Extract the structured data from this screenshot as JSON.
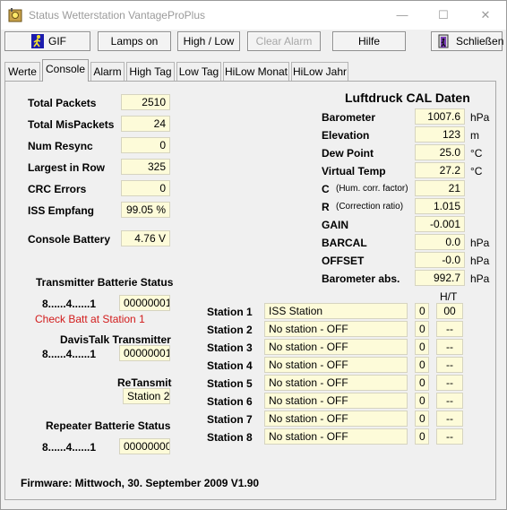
{
  "window": {
    "title": "Status Wetterstation VantageProPlus",
    "min_glyph": "—",
    "max_glyph": "☐",
    "close_glyph": "✕"
  },
  "toolbar": {
    "gif": "GIF",
    "lamps_on": "Lamps on",
    "high_low": "High / Low",
    "clear_alarm": "Clear Alarm",
    "hilfe": "Hilfe",
    "schliessen": "Schließen"
  },
  "tabs": [
    "Werte",
    "Console",
    "Alarm",
    "High Tag",
    "Low Tag",
    "HiLow Monat",
    "HiLow Jahr"
  ],
  "console": {
    "total_packets": {
      "label": "Total Packets",
      "value": "2510"
    },
    "total_mispackets": {
      "label": "Total MisPackets",
      "value": "24"
    },
    "num_resync": {
      "label": "Num Resync",
      "value": "0"
    },
    "largest_in_row": {
      "label": "Largest in Row",
      "value": "325"
    },
    "crc_errors": {
      "label": "CRC Errors",
      "value": "0"
    },
    "iss_empfang": {
      "label": "ISS Empfang",
      "value": "99.05 %"
    },
    "console_battery": {
      "label": "Console Battery",
      "value": "4.76 V"
    }
  },
  "transmitter": {
    "heading": "Transmitter Batterie Status",
    "bits_label": "8......4......1",
    "value": "00000001",
    "warning": "Check Batt at Station 1",
    "davistalk_heading": "DavisTalk Transmitter",
    "davistalk_bits_label": "8......4......1",
    "davistalk_value": "00000001",
    "retransmit_heading": "ReTansmit",
    "retransmit_value": "Station 2",
    "repeater_heading": "Repeater Batterie Status",
    "repeater_bits_label": "8......4......1",
    "repeater_value": "00000000"
  },
  "cal": {
    "heading": "Luftdruck CAL Daten",
    "barometer": {
      "label": "Barometer",
      "value": "1007.6",
      "unit": "hPa"
    },
    "elevation": {
      "label": "Elevation",
      "value": "123",
      "unit": "m"
    },
    "dew_point": {
      "label": "Dew Point",
      "value": "25.0",
      "unit": "°C"
    },
    "virtual_temp": {
      "label": "Virtual Temp",
      "value": "27.2",
      "unit": "°C"
    },
    "c": {
      "label": "C",
      "sub": "(Hum. corr. factor)",
      "value": "21"
    },
    "r": {
      "label": "R",
      "sub": "(Correction ratio)",
      "value": "1.015"
    },
    "gain": {
      "label": "GAIN",
      "value": "-0.001"
    },
    "barcal": {
      "label": "BARCAL",
      "value": "0.0",
      "unit": "hPa"
    },
    "offset": {
      "label": "OFFSET",
      "value": "-0.0",
      "unit": "hPa"
    },
    "barometer_abs": {
      "label": "Barometer abs.",
      "value": "992.7",
      "unit": "hPa"
    }
  },
  "stations": {
    "ht_header": "H/T",
    "rows": [
      {
        "label": "Station 1",
        "name": "ISS Station",
        "count": "0",
        "ht": "00"
      },
      {
        "label": "Station 2",
        "name": "No station - OFF",
        "count": "0",
        "ht": "--"
      },
      {
        "label": "Station 3",
        "name": "No station - OFF",
        "count": "0",
        "ht": "--"
      },
      {
        "label": "Station 4",
        "name": "No station - OFF",
        "count": "0",
        "ht": "--"
      },
      {
        "label": "Station 5",
        "name": "No station - OFF",
        "count": "0",
        "ht": "--"
      },
      {
        "label": "Station 6",
        "name": "No station - OFF",
        "count": "0",
        "ht": "--"
      },
      {
        "label": "Station 7",
        "name": "No station - OFF",
        "count": "0",
        "ht": "--"
      },
      {
        "label": "Station 8",
        "name": "No station - OFF",
        "count": "0",
        "ht": "--"
      }
    ]
  },
  "firmware": "Firmware: Mittwoch, 30. September 2009  V1.90"
}
